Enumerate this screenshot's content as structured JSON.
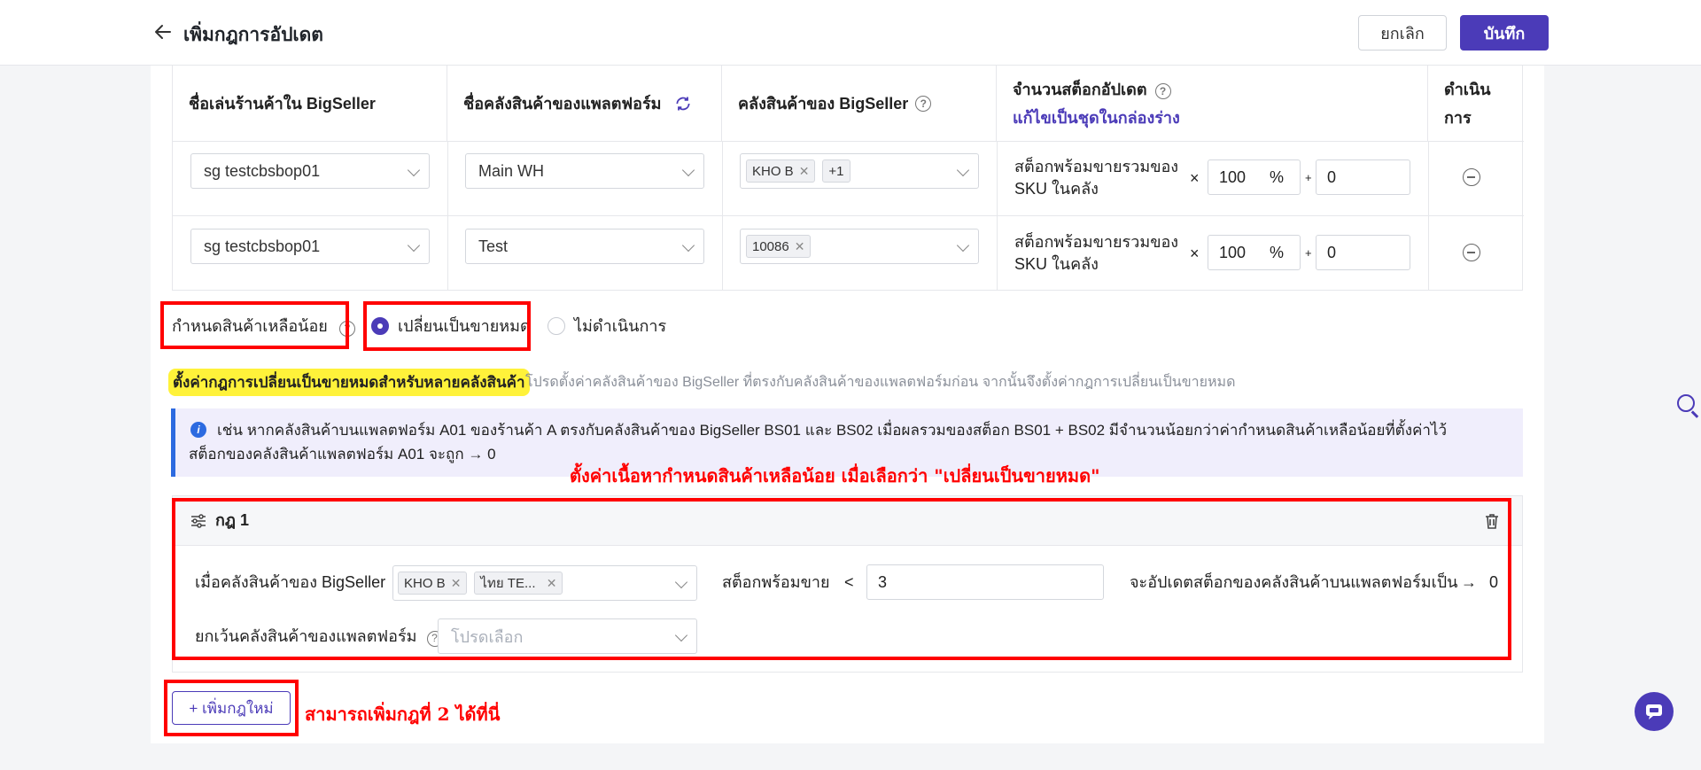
{
  "header": {
    "title": "เพิ่มกฎการอัปเดต",
    "cancel_label": "ยกเลิก",
    "save_label": "บันทึก"
  },
  "table": {
    "columns": {
      "shop_nick": "ชื่อเล่นร้านค้าใน BigSeller",
      "platform_wh": "ชื่อคลังสินค้าของแพลตฟอร์ม",
      "bs_wh": "คลังสินค้าของ BigSeller",
      "stock_update": "จำนวนสต็อกอัปเดต",
      "stock_update_link": "แก้ไขเป็นชุดในกล่องร่าง",
      "action_line1": "ดำเนิน",
      "action_line2": "การ"
    },
    "rows": [
      {
        "shop": "sg testcbsbop01",
        "platform_wh": "Main WH",
        "bs_tags": [
          "KHO B",
          "+1"
        ],
        "stock_text_1": "สต็อกพร้อมขายรวมของ",
        "stock_text_2": "SKU ในคลัง",
        "percent": "100",
        "percent_unit": "%",
        "plus": "+",
        "times": "×",
        "add_value": "0"
      },
      {
        "shop": "sg testcbsbop01",
        "platform_wh": "Test",
        "bs_tags": [
          "10086"
        ],
        "stock_text_1": "สต็อกพร้อมขายรวมของ",
        "stock_text_2": "SKU ในคลัง",
        "percent": "100",
        "percent_unit": "%",
        "plus": "+",
        "times": "×",
        "add_value": "0"
      }
    ]
  },
  "low_stock": {
    "label": "กำหนดสินค้าเหลือน้อย",
    "option_selected": "เปลี่ยนเป็นขายหมด",
    "option_other": "ไม่ดำเนินการ",
    "highlight_title": "ตั้งค่ากฎการเปลี่ยนเป็นขายหมดสำหรับหลายคลังสินค้า",
    "highlight_hint": "โปรดตั้งค่าคลังสินค้าของ BigSeller ที่ตรงกับคลังสินค้าของแพลตฟอร์มก่อน จากนั้นจึงตั้งค่ากฎการเปลี่ยนเป็นขายหมด",
    "info_line1": "เช่น หากคลังสินค้าบนแพลตฟอร์ม A01 ของร้านค้า A ตรงกับคลังสินค้าของ BigSeller BS01 และ BS02 เมื่อผลรวมของสต็อก BS01 + BS02 มีจำนวนน้อยกว่าค่ากำหนดสินค้าเหลือน้อยที่ตั้งค่าไว้",
    "info_line2": "สต็อกของคลังสินค้าแพลตฟอร์ม A01 จะถูก  →  0"
  },
  "rule": {
    "title": "กฎ 1",
    "when_label": "เมื่อคลังสินค้าของ BigSeller",
    "tags": [
      "KHO B",
      "ไทย TE..."
    ],
    "stock_label": "สต็อกพร้อมขาย",
    "lt": "<",
    "threshold": "3",
    "update_label": "จะอัปเดตสต็อกของคลังสินค้าบนแพลตฟอร์มเป็น",
    "arrow": "→",
    "update_value": "0",
    "except_label": "ยกเว้นคลังสินค้าของแพลตฟอร์ม",
    "except_placeholder": "โปรดเลือก"
  },
  "add_rule_label": "+ เพิ่มกฎใหม่",
  "annotations": {
    "low_stock_note": "ตั้งค่าเนื้อหากำหนดสินค้าเหลือน้อย เมื่อเลือกว่า \"เปลี่ยนเป็นขายหมด\"",
    "add_rule_note": "สามารถเพิ่มกฎที่ 2 ได้ที่นี่"
  },
  "colors": {
    "accent": "#4b3bb8",
    "annotation_red": "#ff0000",
    "highlight_yellow": "#fff23a",
    "info_blue": "#2c6ae0"
  }
}
